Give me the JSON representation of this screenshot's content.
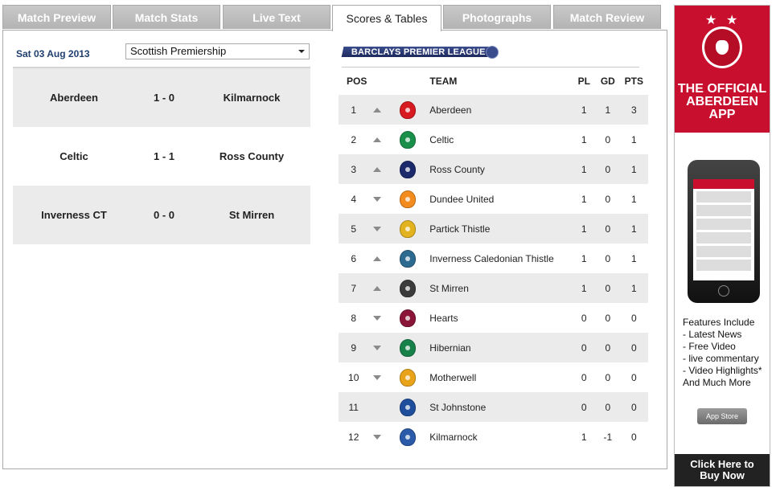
{
  "tabs": [
    {
      "label": "Match Preview",
      "active": false
    },
    {
      "label": "Match Stats",
      "active": false
    },
    {
      "label": "Live Text",
      "active": false
    },
    {
      "label": "Scores & Tables",
      "active": true
    },
    {
      "label": "Photographs",
      "active": false
    },
    {
      "label": "Match Review",
      "active": false
    }
  ],
  "fixtures": {
    "date": "Sat 03 Aug 2013",
    "league_selected": "Scottish Premiership",
    "results": [
      {
        "home": "Aberdeen",
        "score": "1 - 0",
        "away": "Kilmarnock"
      },
      {
        "home": "Celtic",
        "score": "1 - 1",
        "away": "Ross County"
      },
      {
        "home": "Inverness CT",
        "score": "0 - 0",
        "away": "St Mirren"
      }
    ]
  },
  "sponsor": {
    "name": "BARCLAYS PREMIER LEAGUE"
  },
  "league_table": {
    "headers": {
      "pos": "POS",
      "team": "TEAM",
      "pl": "PL",
      "gd": "GD",
      "pts": "PTS"
    },
    "rows": [
      {
        "pos": "1",
        "movement": "up",
        "team": "Aberdeen",
        "pl": "1",
        "gd": "1",
        "pts": "3",
        "crest_color": "#d71920"
      },
      {
        "pos": "2",
        "movement": "up",
        "team": "Celtic",
        "pl": "1",
        "gd": "0",
        "pts": "1",
        "crest_color": "#1a8f4a"
      },
      {
        "pos": "3",
        "movement": "up",
        "team": "Ross County",
        "pl": "1",
        "gd": "0",
        "pts": "1",
        "crest_color": "#1c2a6b"
      },
      {
        "pos": "4",
        "movement": "down",
        "team": "Dundee United",
        "pl": "1",
        "gd": "0",
        "pts": "1",
        "crest_color": "#f28c1e"
      },
      {
        "pos": "5",
        "movement": "down",
        "team": "Partick Thistle",
        "pl": "1",
        "gd": "0",
        "pts": "1",
        "crest_color": "#e2b21f"
      },
      {
        "pos": "6",
        "movement": "up",
        "team": "Inverness Caledonian Thistle",
        "pl": "1",
        "gd": "0",
        "pts": "1",
        "crest_color": "#2d6a8f"
      },
      {
        "pos": "7",
        "movement": "up",
        "team": "St Mirren",
        "pl": "1",
        "gd": "0",
        "pts": "1",
        "crest_color": "#3b3b3b"
      },
      {
        "pos": "8",
        "movement": "down",
        "team": "Hearts",
        "pl": "0",
        "gd": "0",
        "pts": "0",
        "crest_color": "#8a1538"
      },
      {
        "pos": "9",
        "movement": "down",
        "team": "Hibernian",
        "pl": "0",
        "gd": "0",
        "pts": "0",
        "crest_color": "#18814a"
      },
      {
        "pos": "10",
        "movement": "down",
        "team": "Motherwell",
        "pl": "0",
        "gd": "0",
        "pts": "0",
        "crest_color": "#e9a31b"
      },
      {
        "pos": "11",
        "movement": "none",
        "team": "St Johnstone",
        "pl": "0",
        "gd": "0",
        "pts": "0",
        "crest_color": "#1f4f9c"
      },
      {
        "pos": "12",
        "movement": "down",
        "team": "Kilmarnock",
        "pl": "1",
        "gd": "-1",
        "pts": "0",
        "crest_color": "#2a5aa8"
      }
    ]
  },
  "ad": {
    "title_lines": [
      "THE OFFICIAL",
      "ABERDEEN",
      "APP"
    ],
    "features_heading": "Features Include",
    "features": [
      "- Latest News",
      "- Free Video",
      "- live commentary",
      "- Video Highlights*"
    ],
    "features_footer": "And Much More",
    "store_badge": "App Store",
    "cta_lines": [
      "Click Here to",
      "Buy Now"
    ],
    "brand_color": "#c8102e"
  }
}
